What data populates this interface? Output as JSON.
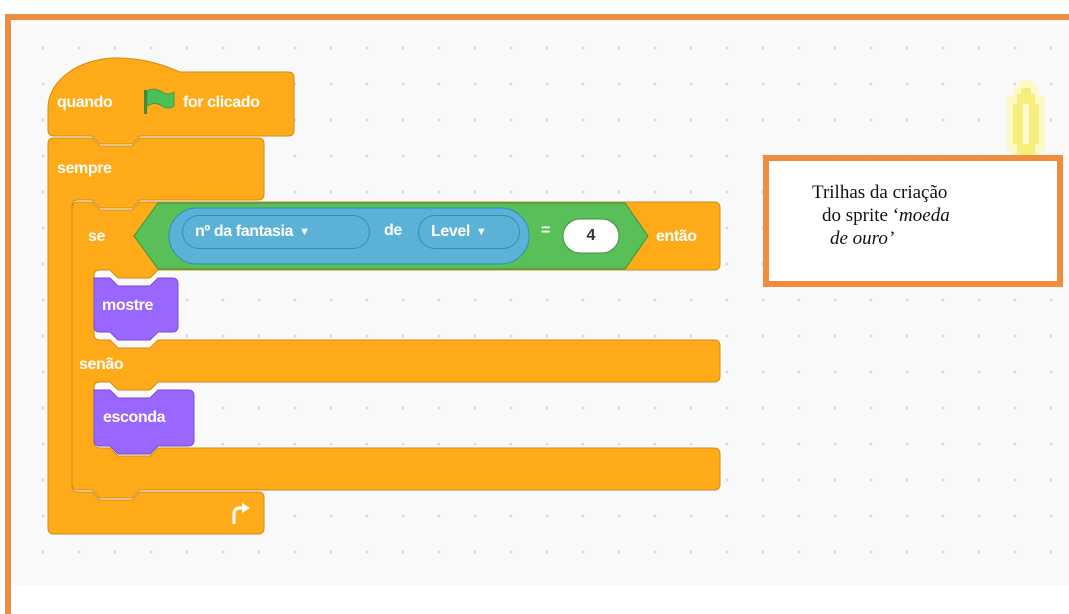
{
  "blocks": {
    "hat_pre": "quando",
    "hat_post": "for clicado",
    "forever": "sempre",
    "if": "se",
    "costume_menu": "nº da fantasia",
    "of": "de",
    "sprite_menu": "Level",
    "equals": "=",
    "compare_value": "4",
    "then": "então",
    "show": "mostre",
    "else": "senão",
    "hide": "esconda"
  },
  "note": {
    "line1": "Trilhas da criação",
    "line2_plain": "do sprite ‘",
    "line2_italic": "moeda",
    "line3_italic": "de ouro’"
  },
  "icons": {
    "flag": "green-flag-icon",
    "dropdown": "caret-down-icon",
    "loop": "loop-arrow-icon",
    "sprite": "gold-coin-sprite"
  },
  "colors": {
    "events": "#ffab19",
    "looks": "#9966ff",
    "operators": "#59c059",
    "sensing": "#5cb1d6",
    "frame": "#f08c3e"
  }
}
